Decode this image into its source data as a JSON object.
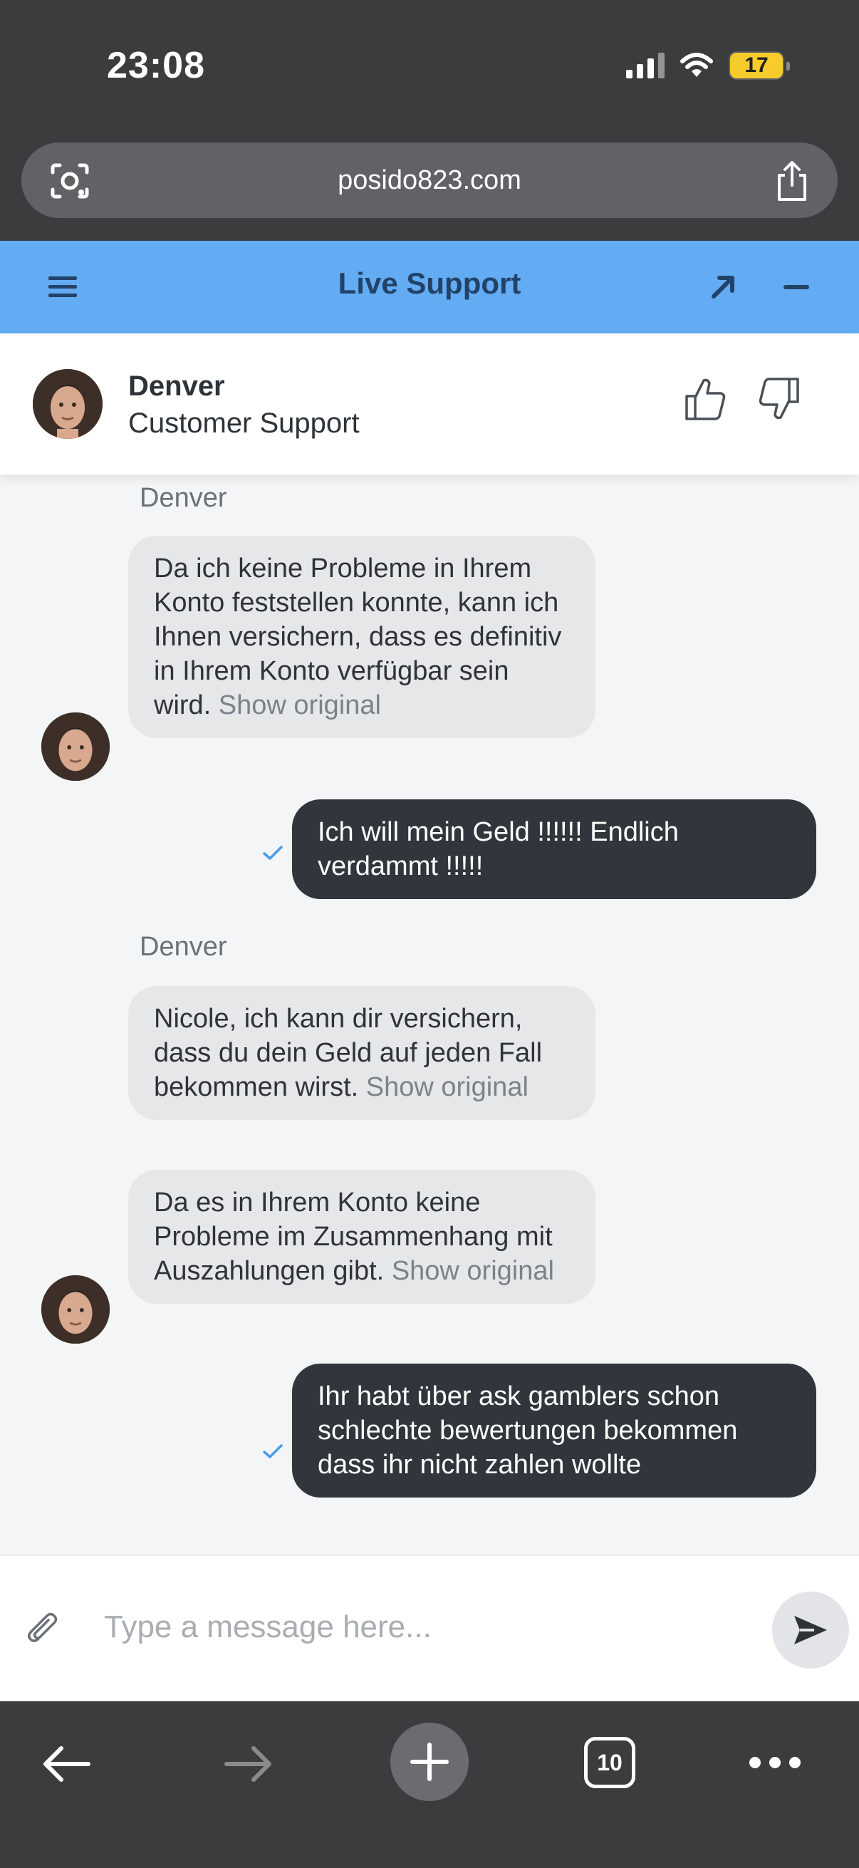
{
  "status_bar": {
    "time": "23:08",
    "battery": "17"
  },
  "browser": {
    "url": "posido823.com",
    "tab_count": "10"
  },
  "live_support": {
    "title": "Live Support"
  },
  "agent": {
    "name": "Denver",
    "role": "Customer Support"
  },
  "messages": [
    {
      "sender": "Denver"
    },
    {
      "text": "Da ich keine Probleme in Ihrem Konto feststellen konnte, kann ich Ihnen versichern, dass es definitiv in Ihrem Konto verfügbar sein wird.",
      "action": "Show original"
    },
    {
      "text": "Ich will mein Geld !!!!!! Endlich verdammt !!!!!"
    },
    {
      "sender": "Denver"
    },
    {
      "text": "Nicole, ich kann dir versichern, dass du dein Geld auf jeden Fall bekommen wirst.",
      "action": "Show original"
    },
    {
      "text": "Da es in Ihrem Konto keine Probleme im Zusammenhang mit Auszahlungen gibt.",
      "action": "Show original"
    },
    {
      "text": "Ihr habt über ask gamblers schon schlechte bewertungen bekommen dass ihr nicht zahlen wollte"
    }
  ],
  "composer": {
    "placeholder": "Type a message here..."
  },
  "colors": {
    "header": "#63acf3",
    "outgoing_bubble": "#31363d",
    "incoming_bubble": "#e6e7e9",
    "read_check": "#4a9be8"
  }
}
